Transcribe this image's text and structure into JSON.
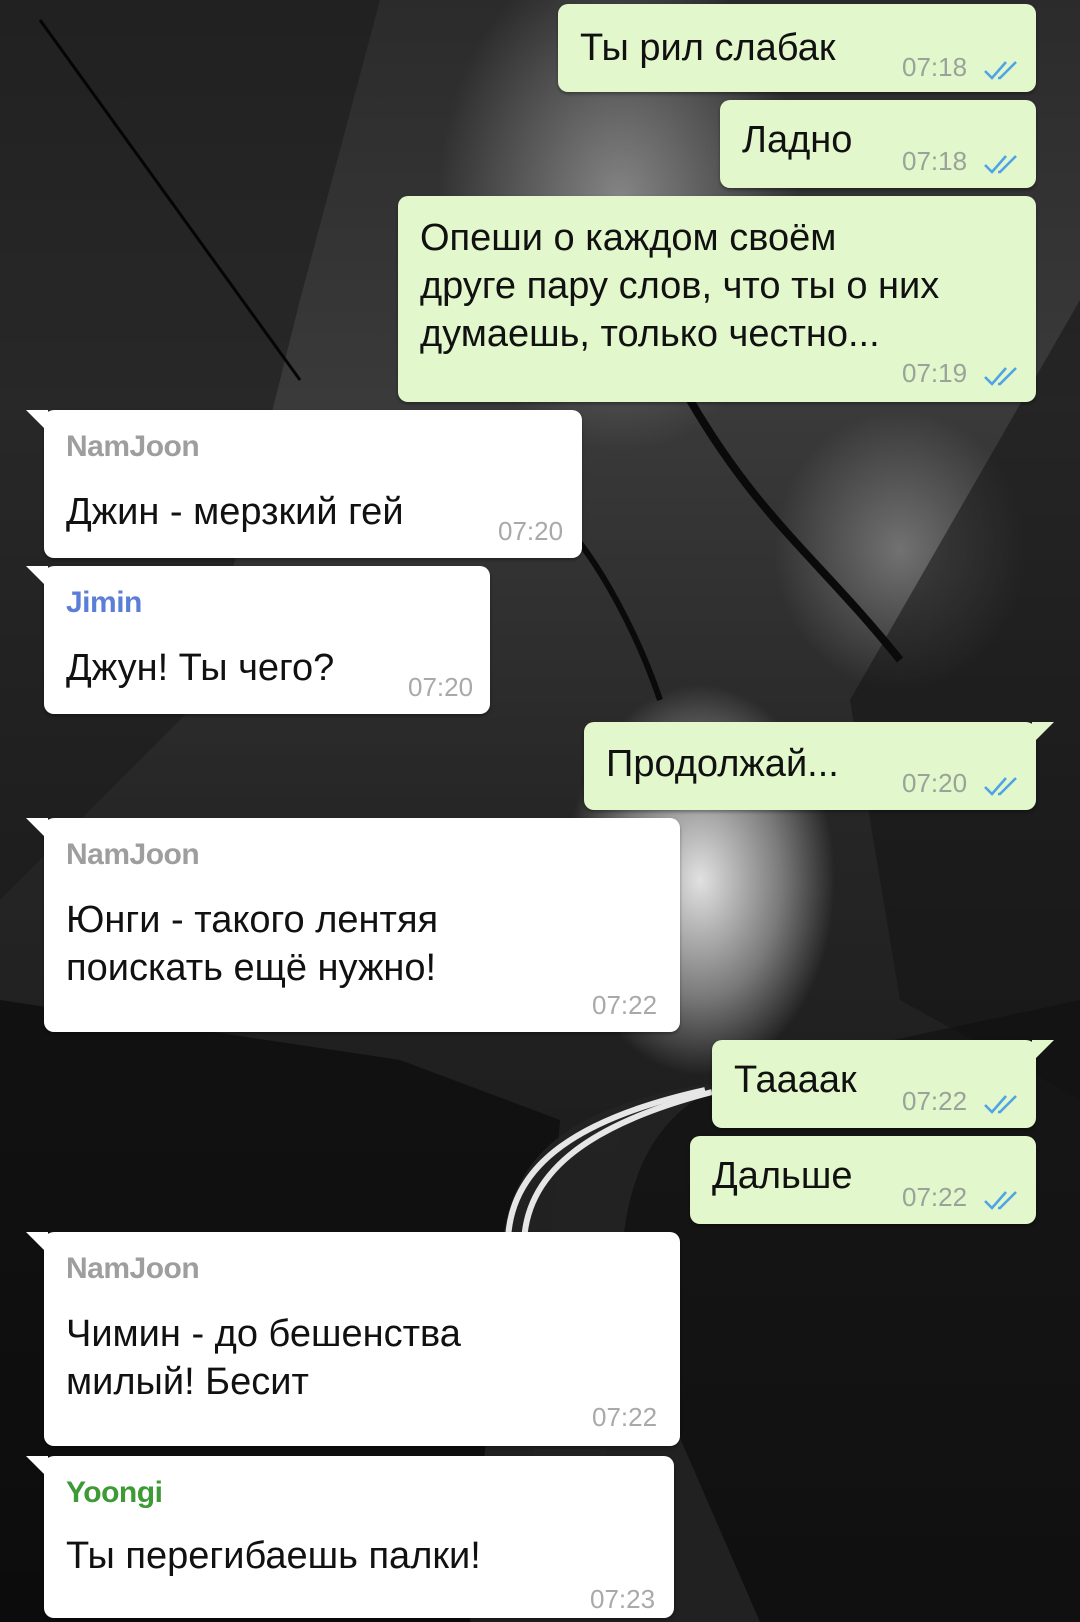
{
  "colors": {
    "outgoing_bubble": "#e2f7cb",
    "incoming_bubble": "#ffffff",
    "read_checks": "#4fa3e6",
    "sender_namjoon": "#9e9e9e",
    "sender_jimin": "#5b7fd9",
    "sender_yoongi": "#3d9a35"
  },
  "icons": {
    "read_status": "double-check-icon"
  },
  "messages": [
    {
      "direction": "out",
      "text": "Ты рил слабак",
      "time": "07:18",
      "status": "read"
    },
    {
      "direction": "out",
      "text": "Ладно",
      "time": "07:18",
      "status": "read"
    },
    {
      "direction": "out",
      "text": "Опеши о каждом своём\nдруге пару слов, что ты о них\nдумаешь, только честно...",
      "time": "07:19",
      "status": "read"
    },
    {
      "direction": "in",
      "sender": "NamJoon",
      "text": "Джин - мерзкий гей",
      "time": "07:20"
    },
    {
      "direction": "in",
      "sender": "Jimin",
      "text": "Джун! Ты чего?",
      "time": "07:20"
    },
    {
      "direction": "out",
      "text": "Продолжай...",
      "time": "07:20",
      "status": "read"
    },
    {
      "direction": "in",
      "sender": "NamJoon",
      "text": "Юнги - такого лентяя\nпоискать ещё нужно!",
      "time": "07:22"
    },
    {
      "direction": "out",
      "text": "Таааак",
      "time": "07:22",
      "status": "read"
    },
    {
      "direction": "out",
      "text": "Дальше",
      "time": "07:22",
      "status": "read"
    },
    {
      "direction": "in",
      "sender": "NamJoon",
      "text": "Чимин - до бешенства\nмилый! Бесит",
      "time": "07:22"
    },
    {
      "direction": "in",
      "sender": "Yoongi",
      "text": "Ты перегибаешь палки!",
      "time": "07:23"
    }
  ]
}
